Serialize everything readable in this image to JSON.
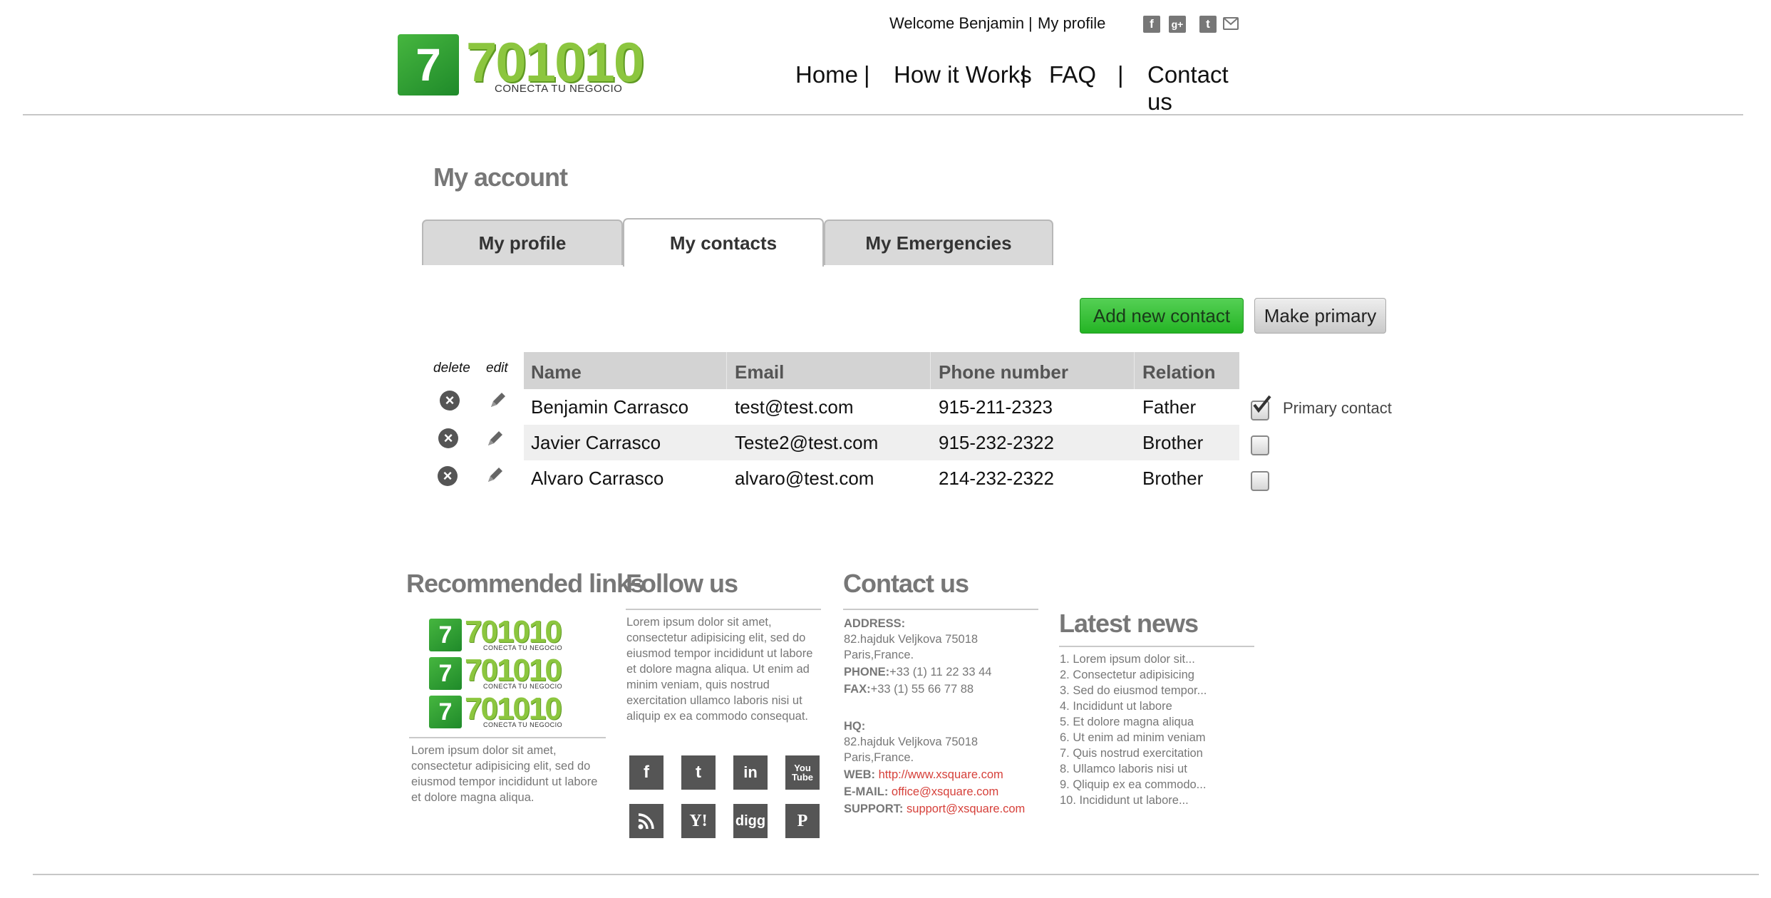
{
  "header": {
    "logo": {
      "digit": "7",
      "number": "701010",
      "tagline": "CONECTA TU NEGOCIO"
    },
    "welcome": "Welcome Benjamin",
    "profile_link": "My profile",
    "social_icons": [
      "facebook-icon",
      "google-plus-icon",
      "twitter-icon",
      "email-icon"
    ],
    "nav": [
      "Home",
      "How it Works",
      "FAQ",
      "Contact us"
    ]
  },
  "page": {
    "title": "My account",
    "tabs": [
      "My profile",
      "My contacts",
      "My Emergencies"
    ],
    "active_tab": "My contacts",
    "buttons": {
      "add": "Add new contact",
      "primary": "Make primary"
    }
  },
  "contacts": {
    "delete_label": "delete",
    "edit_label": "edit",
    "columns": [
      "Name",
      "Email",
      "Phone number",
      "Relation"
    ],
    "rows": [
      {
        "name": "Benjamin Carrasco",
        "email": "test@test.com",
        "phone": "915-211-2323",
        "relation": "Father",
        "primary": true
      },
      {
        "name": "Javier Carrasco",
        "email": "Teste2@test.com",
        "phone": "915-232-2322",
        "relation": "Brother",
        "primary": false
      },
      {
        "name": "Alvaro Carrasco",
        "email": "alvaro@test.com",
        "phone": "214-232-2322",
        "relation": "Brother",
        "primary": false
      }
    ],
    "primary_label": "Primary contact"
  },
  "footer": {
    "recommended": {
      "title": "Recommended links",
      "text": "Lorem ipsum dolor sit amet, consectetur adipisicing elit, sed do eiusmod tempor incididunt ut labore et dolore magna aliqua."
    },
    "follow": {
      "title": "Follow us",
      "text": "Lorem ipsum dolor sit amet, consectetur adipisicing elit, sed do eiusmod tempor incididunt ut labore et dolore magna aliqua. Ut enim ad minim veniam, quis nostrud exercitation ullamco laboris nisi ut aliquip ex ea commodo consequat.",
      "icons": [
        "facebook-icon",
        "twitter-icon",
        "linkedin-icon",
        "youtube-icon",
        "rss-icon",
        "yahoo-icon",
        "digg-icon",
        "pinterest-icon"
      ]
    },
    "contact": {
      "title": "Contact us",
      "address_label": "ADDRESS:",
      "address_1": "82.hajduk Veljkova 75018",
      "address_2": "Paris,France.",
      "phone_label": "PHONE:",
      "phone": "+33 (1) 11 22 33 44",
      "fax_label": "FAX:",
      "fax": "+33 (1) 55 66 77 88",
      "hq_label": "HQ:",
      "hq_1": "82.hajduk Veljkova 75018",
      "hq_2": "Paris,France.",
      "web_label": "WEB:",
      "web": "http://www.xsquare.com",
      "email_label": "E-MAIL:",
      "email": "office@xsquare.com",
      "support_label": "SUPPORT:",
      "support": "support@xsquare.com"
    },
    "news": {
      "title": "Latest news",
      "items": [
        "1. Lorem ipsum dolor sit...",
        "2. Consectetur adipisicing",
        "3. Sed do eiusmod tempor...",
        "4. Incididunt ut labore",
        "5. Et dolore magna aliqua",
        "6. Ut enim ad minim veniam",
        "7. Quis nostrud exercitation",
        "8. Ullamco laboris nisi ut",
        "9. Qliquip ex ea commodo...",
        "10. Incididunt ut labore..."
      ]
    }
  }
}
